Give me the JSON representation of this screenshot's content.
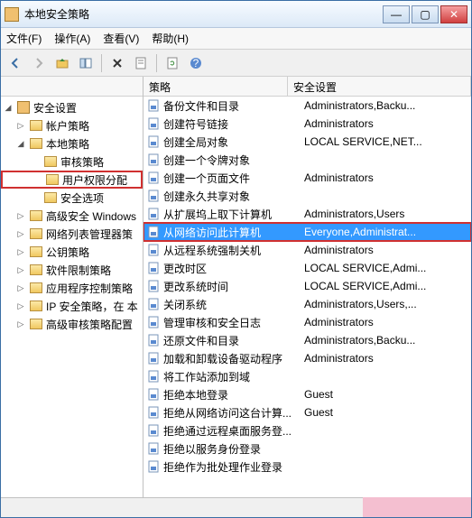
{
  "window": {
    "title": "本地安全策略"
  },
  "menu": {
    "file": "文件(F)",
    "action": "操作(A)",
    "view": "查看(V)",
    "help": "帮助(H)"
  },
  "toolbar": {
    "back": "back",
    "forward": "forward",
    "up": "up",
    "props": "properties",
    "delete": "delete",
    "copy": "copy",
    "refresh": "refresh",
    "help": "help"
  },
  "tree": {
    "header": "",
    "root": "安全设置",
    "nodes": [
      {
        "label": "帐户策略"
      },
      {
        "label": "本地策略",
        "children": [
          {
            "label": "审核策略"
          },
          {
            "label": "用户权限分配",
            "highlight": true
          },
          {
            "label": "安全选项"
          }
        ]
      },
      {
        "label": "高级安全 Windows"
      },
      {
        "label": "网络列表管理器策"
      },
      {
        "label": "公钥策略"
      },
      {
        "label": "软件限制策略"
      },
      {
        "label": "应用程序控制策略"
      },
      {
        "label": "IP 安全策略，在 本"
      },
      {
        "label": "高级审核策略配置"
      }
    ]
  },
  "list": {
    "headers": {
      "policy": "策略",
      "security": "安全设置"
    },
    "rows": [
      {
        "policy": "备份文件和目录",
        "security": "Administrators,Backu..."
      },
      {
        "policy": "创建符号链接",
        "security": "Administrators"
      },
      {
        "policy": "创建全局对象",
        "security": "LOCAL SERVICE,NET..."
      },
      {
        "policy": "创建一个令牌对象",
        "security": ""
      },
      {
        "policy": "创建一个页面文件",
        "security": "Administrators"
      },
      {
        "policy": "创建永久共享对象",
        "security": ""
      },
      {
        "policy": "从扩展坞上取下计算机",
        "security": "Administrators,Users"
      },
      {
        "policy": "从网络访问此计算机",
        "security": "Everyone,Administrat...",
        "selected": true,
        "highlight": true
      },
      {
        "policy": "从远程系统强制关机",
        "security": "Administrators"
      },
      {
        "policy": "更改时区",
        "security": "LOCAL SERVICE,Admi..."
      },
      {
        "policy": "更改系统时间",
        "security": "LOCAL SERVICE,Admi..."
      },
      {
        "policy": "关闭系统",
        "security": "Administrators,Users,..."
      },
      {
        "policy": "管理审核和安全日志",
        "security": "Administrators"
      },
      {
        "policy": "还原文件和目录",
        "security": "Administrators,Backu..."
      },
      {
        "policy": "加载和卸载设备驱动程序",
        "security": "Administrators"
      },
      {
        "policy": "将工作站添加到域",
        "security": ""
      },
      {
        "policy": "拒绝本地登录",
        "security": "Guest"
      },
      {
        "policy": "拒绝从网络访问这台计算...",
        "security": "Guest"
      },
      {
        "policy": "拒绝通过远程桌面服务登...",
        "security": ""
      },
      {
        "policy": "拒绝以服务身份登录",
        "security": ""
      },
      {
        "policy": "拒绝作为批处理作业登录",
        "security": ""
      }
    ]
  }
}
